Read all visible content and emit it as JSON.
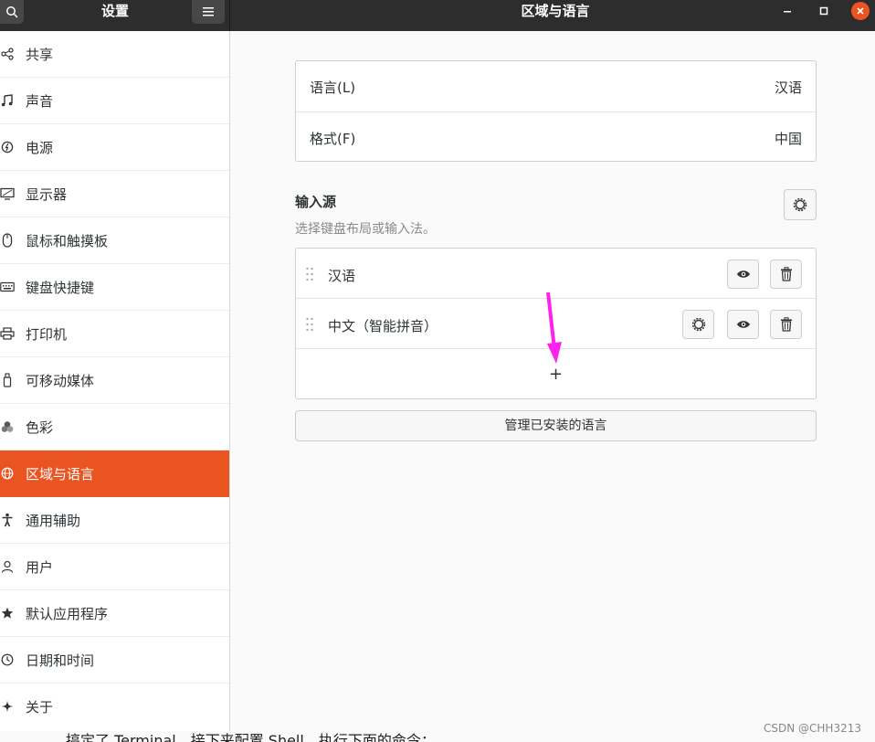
{
  "header": {
    "sidebar_title": "设置",
    "window_title": "区域与语言"
  },
  "sidebar": {
    "items": [
      {
        "label": "共享",
        "icon": "share-icon"
      },
      {
        "label": "声音",
        "icon": "music-note-icon"
      },
      {
        "label": "电源",
        "icon": "power-icon"
      },
      {
        "label": "显示器",
        "icon": "display-icon"
      },
      {
        "label": "鼠标和触摸板",
        "icon": "mouse-icon"
      },
      {
        "label": "键盘快捷键",
        "icon": "keyboard-icon"
      },
      {
        "label": "打印机",
        "icon": "printer-icon"
      },
      {
        "label": "可移动媒体",
        "icon": "usb-drive-icon"
      },
      {
        "label": "色彩",
        "icon": "color-icon"
      },
      {
        "label": "区域与语言",
        "icon": "globe-icon",
        "active": true
      },
      {
        "label": "通用辅助",
        "icon": "accessibility-icon"
      },
      {
        "label": "用户",
        "icon": "user-icon"
      },
      {
        "label": "默认应用程序",
        "icon": "star-icon"
      },
      {
        "label": "日期和时间",
        "icon": "clock-icon"
      },
      {
        "label": "关于",
        "icon": "sparkle-icon"
      }
    ]
  },
  "region": {
    "language_label": "语言(L)",
    "language_value": "汉语",
    "formats_label": "格式(F)",
    "formats_value": "中国"
  },
  "input_sources": {
    "title": "输入源",
    "subtitle": "选择键盘布局或输入法。",
    "items": [
      {
        "label": "汉语"
      },
      {
        "label": "中文（智能拼音）"
      }
    ],
    "add_label": "+"
  },
  "manage_button": "管理已安装的语言",
  "annotation_color": "#ff22ee",
  "accent_color": "#e95420",
  "watermark": "CSDN @CHH3213",
  "bottom_text": "搞定了 Terminal，接下来配置 Shell，执行下面的命令："
}
